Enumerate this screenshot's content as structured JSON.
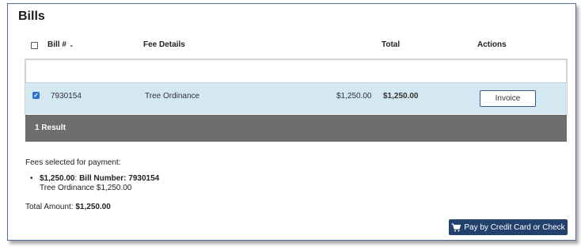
{
  "section": {
    "title": "Bills"
  },
  "table": {
    "headers": {
      "bill": "Bill #",
      "bill_sort_icon": "chevron-down-icon",
      "fee": "Fee Details",
      "total": "Total",
      "actions": "Actions"
    },
    "rows": [
      {
        "checked": true,
        "bill_number": "7930154",
        "fee_details": "Tree Ordinance",
        "amount": "$1,250.00",
        "total": "$1,250.00",
        "action_label": "Invoice"
      }
    ],
    "result_count": "1 Result"
  },
  "fees": {
    "label": "Fees selected for payment:",
    "items": [
      {
        "amount": "$1,250.00",
        "sep": ": ",
        "bill_label": "Bill Number: 7930154",
        "detail": "Tree Ordinance $1,250.00"
      }
    ],
    "total_label": "Total Amount: ",
    "total_value": "$1,250.00"
  },
  "pay_button": {
    "label": "Pay by Credit Card or Check",
    "icon": "cart-icon"
  },
  "colors": {
    "row_highlight": "#d3e8f1",
    "footer_bar": "#6e6e6e",
    "pay_button": "#22416d",
    "checkbox": "#2b6fd0"
  }
}
